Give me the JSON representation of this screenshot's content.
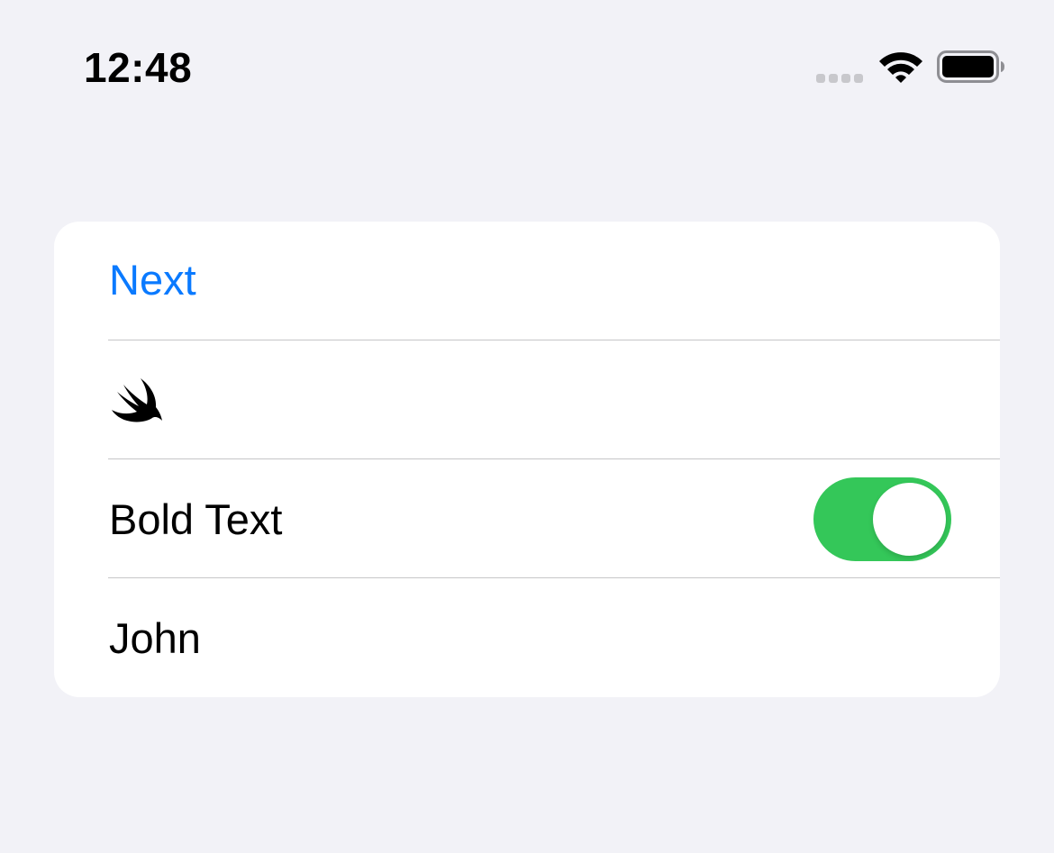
{
  "status_bar": {
    "time": "12:48",
    "icons": [
      "cellular-signal-icon",
      "wifi-icon",
      "battery-icon"
    ]
  },
  "list": {
    "rows": [
      {
        "type": "button",
        "label": "Next",
        "color": "#0a7aff"
      },
      {
        "type": "image",
        "icon": "swift-logo-icon"
      },
      {
        "type": "toggle",
        "label": "Bold Text",
        "on": true,
        "on_color": "#34c759"
      },
      {
        "type": "text",
        "label": "John"
      }
    ]
  },
  "colors": {
    "background": "#f2f2f7",
    "card": "#ffffff",
    "separator": "#c6c6c8"
  }
}
